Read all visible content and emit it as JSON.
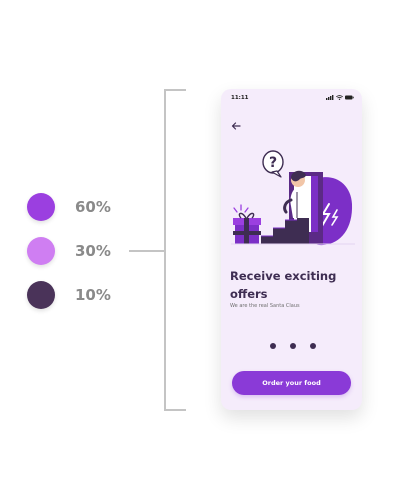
{
  "palette": [
    {
      "color": "#9b3fe0",
      "percent": "60%"
    },
    {
      "color": "#cf7ef2",
      "percent": "30%"
    },
    {
      "color": "#4a3359",
      "percent": "10%"
    }
  ],
  "phone": {
    "status_time": "11:11",
    "back_icon": "arrow-left-icon",
    "title": "Receive exciting offers",
    "subtitle": "We are the real Santa Claus",
    "pager_dot_count": 3,
    "cta_label": "Order your food",
    "accent": "#8a3ad7",
    "background": "#f5ecfb",
    "text_dark": "#3e2d52"
  }
}
